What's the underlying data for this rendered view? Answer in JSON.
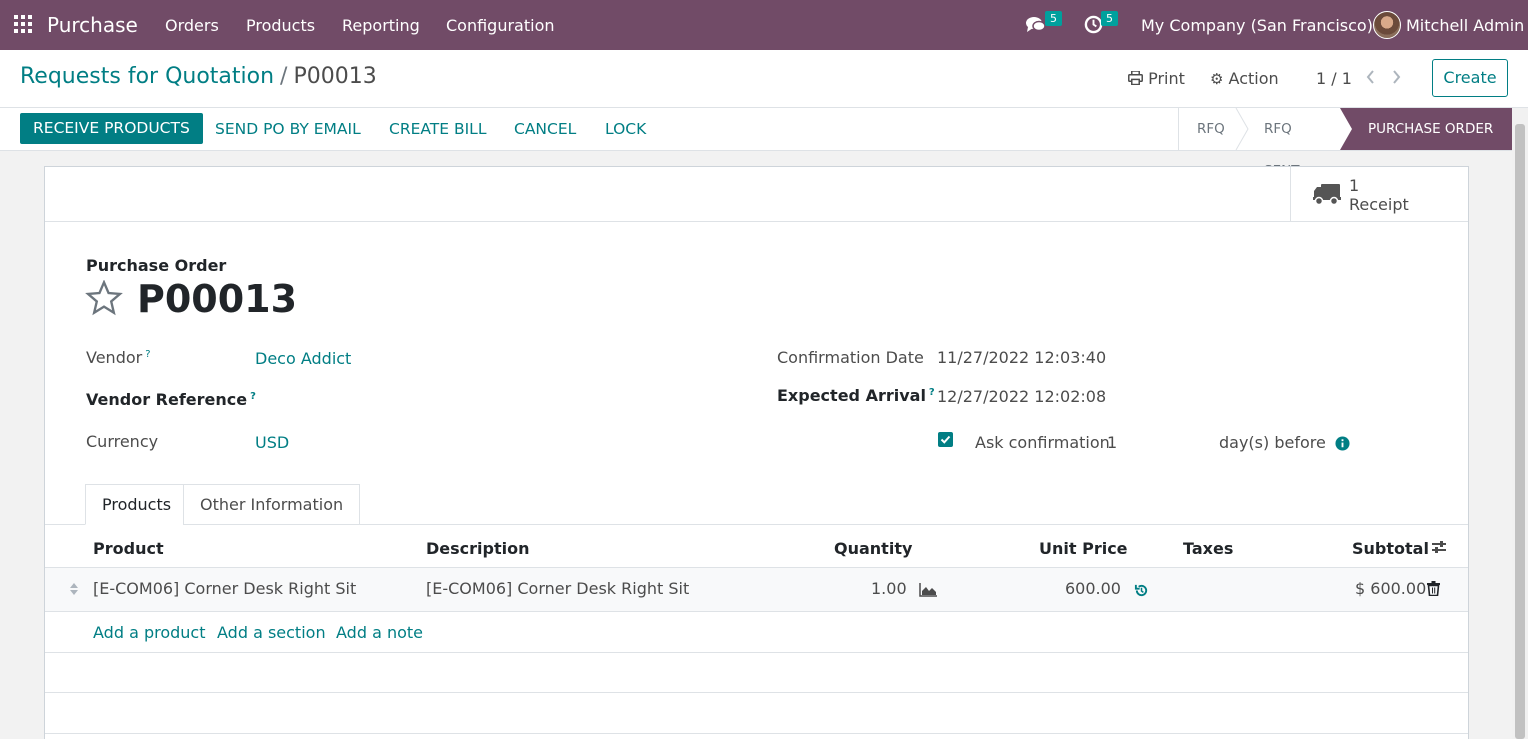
{
  "navbar": {
    "app_name": "Purchase",
    "menu": [
      "Orders",
      "Products",
      "Reporting",
      "Configuration"
    ],
    "messages_count": "5",
    "activities_count": "5",
    "company": "My Company (San Francisco)",
    "user": "Mitchell Admin",
    "bg_color": "#714B67"
  },
  "control_panel": {
    "breadcrumb_parent": "Requests for Quotation",
    "breadcrumb_separator": "/",
    "breadcrumb_current": "P00013",
    "print_label": "Print",
    "action_label": "Action",
    "pager": "1 / 1",
    "create_label": "Create"
  },
  "statusbar": {
    "buttons": [
      "RECEIVE PRODUCTS",
      "SEND PO BY EMAIL",
      "CREATE BILL",
      "CANCEL",
      "LOCK"
    ],
    "stages": [
      "RFQ",
      "RFQ SENT",
      "PURCHASE ORDER"
    ],
    "active_stage": "PURCHASE ORDER"
  },
  "smart_button": {
    "count": "1",
    "label": "Receipt",
    "icon": "truck-icon"
  },
  "form": {
    "doc_type": "Purchase Order",
    "name": "P00013",
    "vendor_label": "Vendor",
    "vendor": "Deco Addict",
    "vendor_ref_label": "Vendor Reference",
    "vendor_ref": "",
    "currency_label": "Currency",
    "currency": "USD",
    "confirmation_date_label": "Confirmation Date",
    "confirmation_date": "11/27/2022 12:03:40",
    "expected_arrival_label": "Expected Arrival",
    "expected_arrival": "12/27/2022 12:02:08",
    "ask_confirmation_label": "Ask confirmation",
    "ask_confirmation_checked": true,
    "ask_confirmation_days": "1",
    "days_before_label": "day(s) before",
    "help_mark": "?"
  },
  "tabs": [
    "Products",
    "Other Information"
  ],
  "order_lines": {
    "headers": [
      "Product",
      "Description",
      "Quantity",
      "Unit Price",
      "Taxes",
      "Subtotal"
    ],
    "rows": [
      {
        "product": "[E-COM06] Corner Desk Right Sit",
        "description": "[E-COM06] Corner Desk Right Sit",
        "quantity": "1.00",
        "unit_price": "600.00",
        "taxes": "",
        "subtotal": "$ 600.00"
      }
    ],
    "add_links": [
      "Add a product",
      "Add a section",
      "Add a note"
    ]
  },
  "colors": {
    "brand": "#714B67",
    "accent": "#017E84",
    "badge": "#00A09D"
  }
}
